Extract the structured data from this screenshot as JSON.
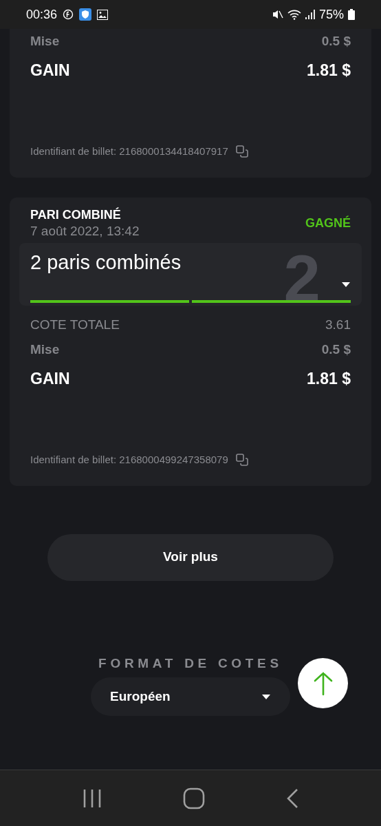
{
  "status_bar": {
    "time": "00:36",
    "battery": "75%"
  },
  "tickets": [
    {
      "cut_top": true,
      "stake_label": "Mise",
      "stake": "0.5 $",
      "gain_label": "GAIN",
      "gain": "1.81 $",
      "ticket_label": "Identifiant de billet: 2168000134418407917"
    },
    {
      "cut_top": false,
      "type": "PARI COMBINÉ",
      "date": "7 août 2022, 13:42",
      "status": "GAGNÉ",
      "selections": {
        "title": "2 paris combinés",
        "count": "2",
        "expanded": false,
        "legs": [
          {
            "won": true
          },
          {
            "won": true
          }
        ]
      },
      "odds_label": "COTE TOTALE",
      "odds": "3.61",
      "stake_label": "Mise",
      "stake": "0.5 $",
      "gain_label": "GAIN",
      "gain": "1.81 $",
      "ticket_label": "Identifiant de billet: 2168000499247358079"
    }
  ],
  "more_button": "Voir plus",
  "odds_format": {
    "label": "FORMAT DE COTES",
    "value": "Européen"
  }
}
